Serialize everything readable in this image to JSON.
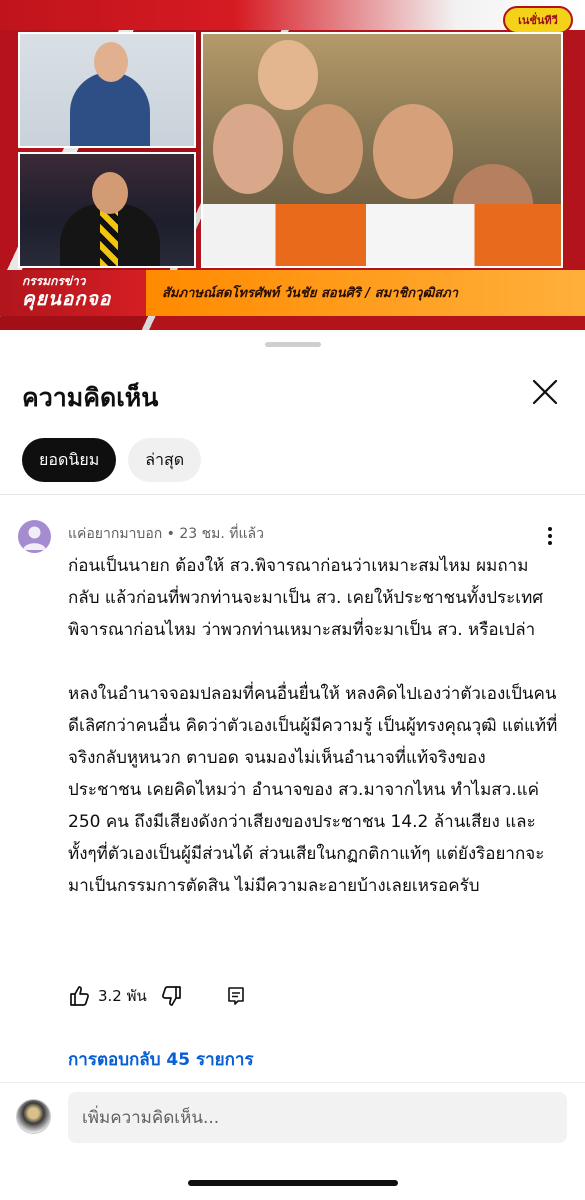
{
  "video": {
    "channel_logo": "เนชั่นทีวี",
    "show_name_top": "กรรมกรข่าว",
    "show_name_bottom": "คุยนอกจอ",
    "caption": "สัมภาษณ์สดโทรศัพท์ วันชัย สอนศิริ / สมาชิกวุฒิสภา"
  },
  "sheet": {
    "title": "ความคิดเห็น",
    "close_icon": "close-icon"
  },
  "sort_chips": {
    "top": "ยอดนิยม",
    "newest": "ล่าสุด"
  },
  "comment": {
    "author": "แค่อยากมาบอก",
    "separator": "•",
    "time": "23 ชม. ที่แล้ว",
    "paragraph_1": "ก่อนเป็นนายก ต้องให้ สว.พิจารณาก่อนว่าเหมาะสมไหม ผมถามกลับ แล้วก่อนที่พวกท่านจะมาเป็น สว. เคยให้ประชาชนทั้งประเทศพิจารณาก่อนไหม ว่าพวกท่านเหมาะสมที่จะมาเป็น สว. หรือเปล่า",
    "paragraph_2": "หลงในอำนาจจอมปลอมที่คนอื่นยื่นให้ หลงคิดไปเองว่าตัวเองเป็นคนดีเลิศกว่าคนอื่น คิดว่าตัวเองเป็นผู้มีความรู้ เป็นผู้ทรงคุณวุฒิ แต่แท้ที่จริงกลับหูหนวก ตาบอด จนมองไม่เห็นอำนาจที่แท้จริงของประชาชน เคยคิดไหมว่า อำนาจของ สว.มาจากไหน ทำไมสว.แค่ 250 คน ถึงมีเสียงดังกว่าเสียงของประชาชน 14.2 ล้านเสียง และ ทั้งๆที่ตัวเองเป็นผู้มีส่วนได้ ส่วนเสียในกฏกติกาแท้ๆ แต่ยังริอยากจะมาเป็นกรรมการตัดสิน ไม่มีความละอายบ้างเลยเหรอครับ",
    "like_count": "3.2 พัน",
    "replies": "การตอบกลับ 45 รายการ"
  },
  "composer": {
    "placeholder": "เพิ่มความคิดเห็น..."
  },
  "colors": {
    "accent_link": "#065fd4",
    "chip_active_bg": "#0f0f0f",
    "chip_inactive_bg": "#f0f0f0",
    "avatar_bg": "#a58bd0"
  }
}
